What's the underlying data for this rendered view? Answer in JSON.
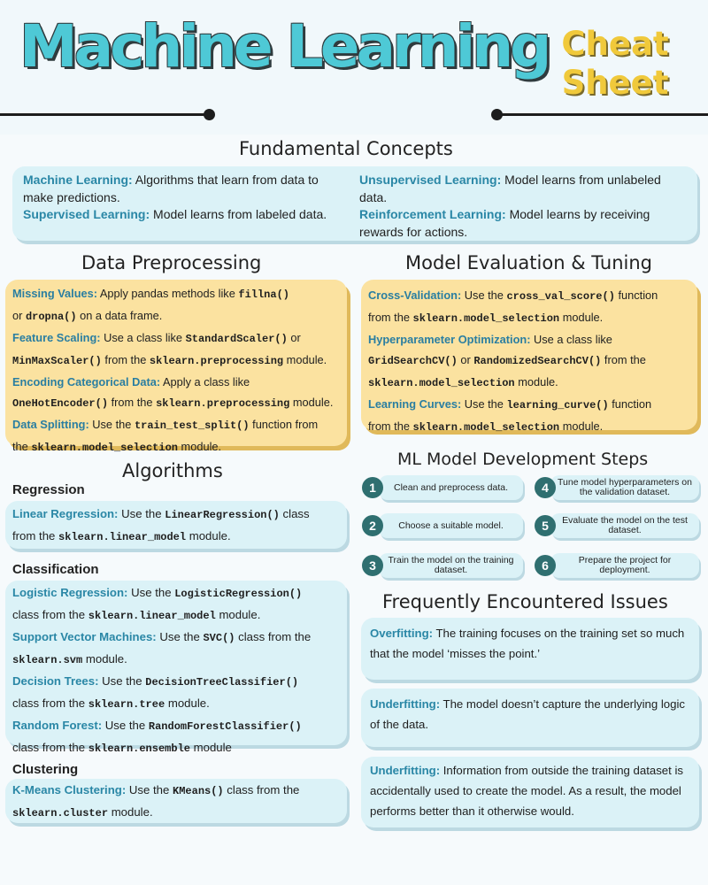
{
  "header": {
    "title": "Machine Learning",
    "subtitle_line1": "Cheat",
    "subtitle_line2": "Sheet"
  },
  "fundamentals": {
    "title": "Fundamental Concepts",
    "ml_term": "Machine Learning:",
    "ml_text": " Algorithms that learn from data to make predictions.",
    "sup_term": "Supervised Learning:",
    "sup_text": " Model learns from labeled data.",
    "unsup_term": "Unsupervised Learning:",
    "unsup_text": " Model learns from unlabeled data.",
    "rl_term": "Reinforcement Learning:",
    "rl_text": " Model learns by receiving rewards for actions."
  },
  "preprocessing": {
    "title": "Data Preprocessing",
    "mv_term": "Missing Values:",
    "mv_text1": " Apply pandas methods like ",
    "mv_code1": "fillna()",
    "mv_text2": "or ",
    "mv_code2": "dropna()",
    "mv_text3": " on a data frame.",
    "fs_term": "Feature Scaling:",
    "fs_text1": " Use a class like ",
    "fs_code1": "StandardScaler()",
    "fs_text2": " or",
    "fs_code2": "MinMaxScaler()",
    "fs_text3": " from the ",
    "fs_code3": "sklearn.preprocessing",
    "fs_text4": " module.",
    "ec_term": "Encoding Categorical Data:",
    "ec_text1": " Apply a class like",
    "ec_code1": "OneHotEncoder()",
    "ec_text2": " from the ",
    "ec_code2": "sklearn.preprocessing",
    "ec_text3": " module.",
    "ds_term": "Data Splitting:",
    "ds_text1": " Use the ",
    "ds_code1": "train_test_split()",
    "ds_text2": " function from",
    "ds_text3": "the ",
    "ds_code2": "sklearn.model_selection",
    "ds_text4": " module."
  },
  "evaluation": {
    "title": "Model Evaluation & Tuning",
    "cv_term": "Cross-Validation:",
    "cv_text1": " Use the ",
    "cv_code1": "cross_val_score()",
    "cv_text2": " function",
    "cv_text3": "from the ",
    "cv_code2": "sklearn.model_selection",
    "cv_text4": " module.",
    "ho_term": "Hyperparameter Optimization:",
    "ho_text1": " Use a class like",
    "ho_code1": "GridSearchCV()",
    "ho_text2": " or ",
    "ho_code2": "RandomizedSearchCV()",
    "ho_text3": " from the",
    "ho_code3": "sklearn.model_selection",
    "ho_text4": " module.",
    "lc_term": "Learning Curves:",
    "lc_text1": " Use the ",
    "lc_code1": "learning_curve()",
    "lc_text2": " function",
    "lc_text3": "from the ",
    "lc_code2": "sklearn.model_selection",
    "lc_text4": " module."
  },
  "algorithms": {
    "title": "Algorithms",
    "regression": {
      "heading": "Regression",
      "lr_term": "Linear Regression:",
      "lr_text1": " Use the ",
      "lr_code1": "LinearRegression()",
      "lr_text2": " class",
      "lr_text3": "from the ",
      "lr_code2": "sklearn.linear_model",
      "lr_text4": " module."
    },
    "classification": {
      "heading": "Classification",
      "log_term": "Logistic Regression:",
      "log_text1": " Use the ",
      "log_code1": "LogisticRegression()",
      "log_text2": "class from the ",
      "log_code2": "sklearn.linear_model",
      "log_text3": " module.",
      "svm_term": "Support Vector Machines:",
      "svm_text1": " Use the ",
      "svm_code1": "SVC()",
      "svm_text2": " class from the",
      "svm_code2": "sklearn.svm",
      "svm_text3": " module.",
      "dt_term": "Decision Trees:",
      "dt_text1": " Use the ",
      "dt_code1": "DecisionTreeClassifier()",
      "dt_text2": "class from the ",
      "dt_code2": "sklearn.tree",
      "dt_text3": " module.",
      "rf_term": "Random Forest:",
      "rf_text1": " Use the ",
      "rf_code1": "RandomForestClassifier()",
      "rf_text2": "class from the ",
      "rf_code2": "sklearn.ensemble",
      "rf_text3": " module"
    },
    "clustering": {
      "heading": "Clustering",
      "km_term": "K-Means Clustering:",
      "km_text1": " Use the ",
      "km_code1": "KMeans()",
      "km_text2": " class from the",
      "km_code2": "sklearn.cluster",
      "km_text3": " module."
    }
  },
  "steps": {
    "title": "ML Model Development Steps",
    "items": [
      {
        "num": "1",
        "text": "Clean and preprocess data."
      },
      {
        "num": "2",
        "text": "Choose a suitable model."
      },
      {
        "num": "3",
        "text": "Train the model on the training dataset."
      },
      {
        "num": "4",
        "text": "Tune model hyperparameters on the validation dataset."
      },
      {
        "num": "5",
        "text": "Evaluate the model on the test dataset."
      },
      {
        "num": "6",
        "text": "Prepare the project for deployment."
      }
    ]
  },
  "issues": {
    "title": "Frequently Encountered Issues",
    "items": [
      {
        "term": "Overfitting:",
        "text": " The training focuses on the training set so much that the model ‘misses the point.’"
      },
      {
        "term": "Underfitting:",
        "text": " The model doesn’t capture the underlying logic of the data."
      },
      {
        "term": "Underfitting:",
        "text": " Information from outside the training dataset is accidentally used to create the model. As a result, the model performs better than it otherwise would."
      }
    ]
  }
}
